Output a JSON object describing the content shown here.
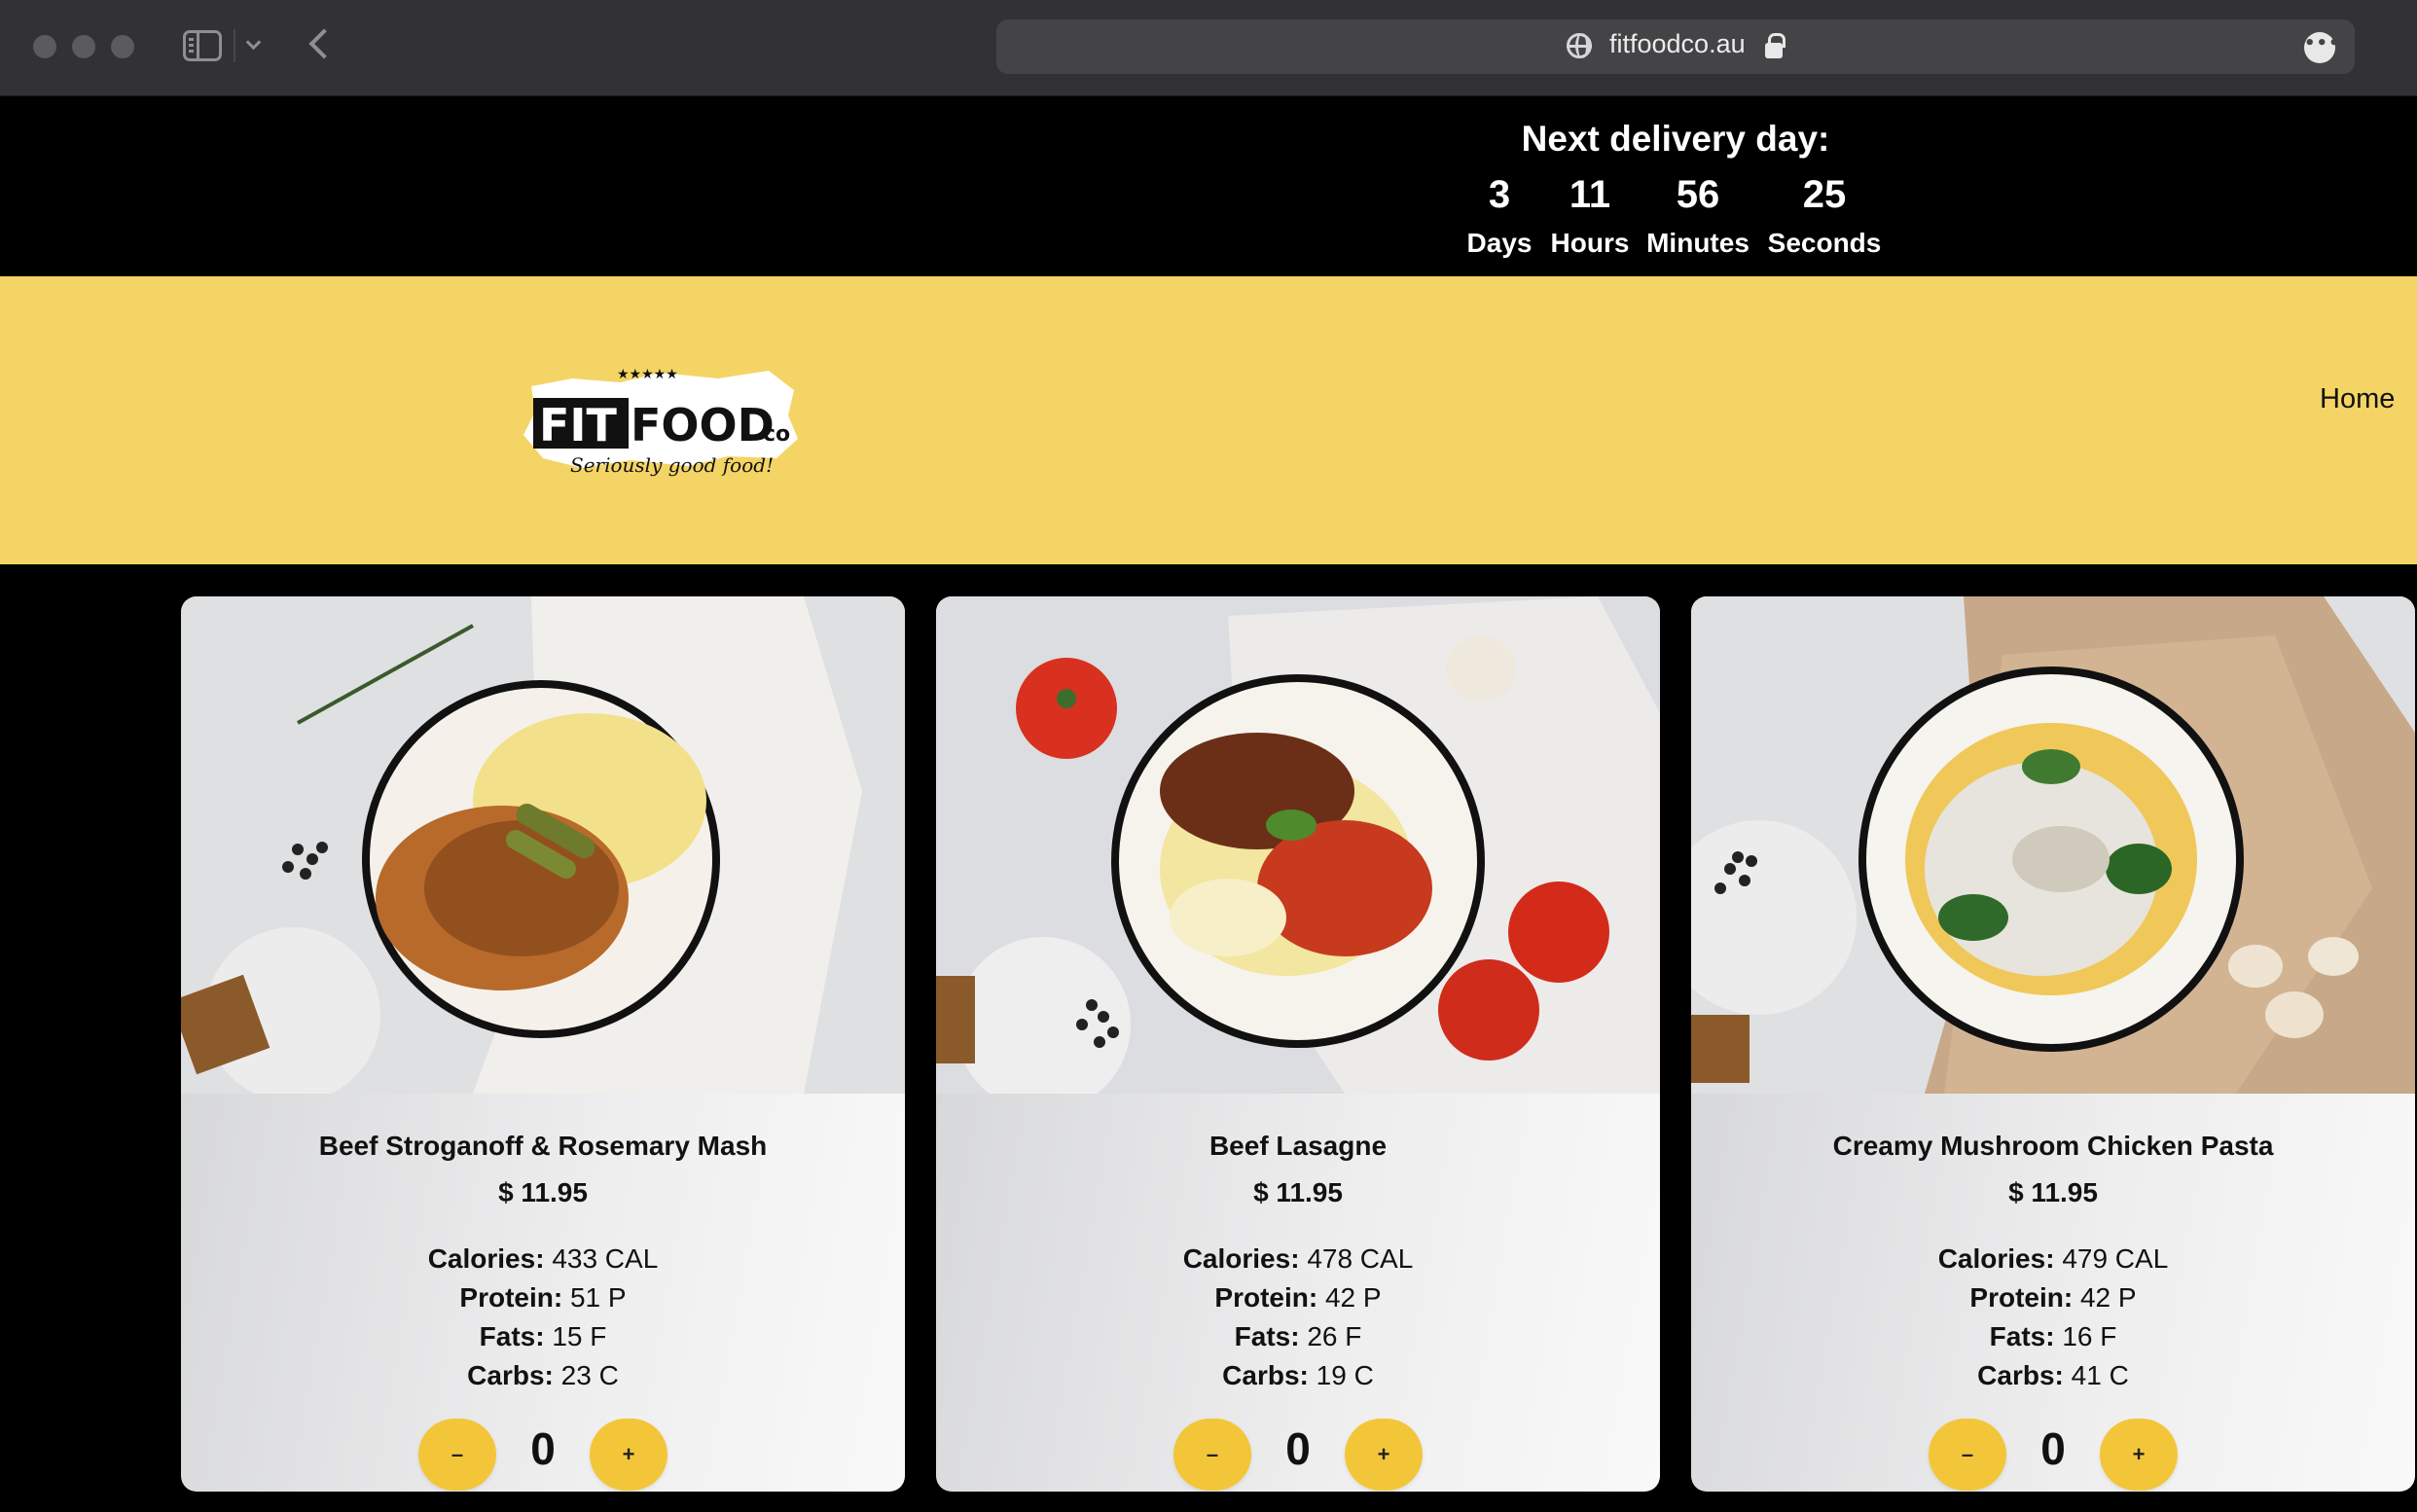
{
  "browser": {
    "url": "fitfoodco.au"
  },
  "countdown": {
    "title": "Next delivery day:",
    "units": [
      {
        "value": "3",
        "label": "Days"
      },
      {
        "value": "11",
        "label": "Hours"
      },
      {
        "value": "56",
        "label": "Minutes"
      },
      {
        "value": "25",
        "label": "Seconds"
      }
    ]
  },
  "header": {
    "logo": {
      "text_fit": "FIT",
      "text_food": "FOOD",
      "text_co": "co",
      "tagline": "Seriously good food!",
      "stars": "★★★★★"
    },
    "nav": {
      "home_label": "Home"
    }
  },
  "products": [
    {
      "name": "Beef Stroganoff & Rosemary Mash",
      "price": "$ 11.95",
      "calories_label": "Calories:",
      "calories": "433 CAL",
      "protein_label": "Protein:",
      "protein": "51 P",
      "fats_label": "Fats:",
      "fats": "15 F",
      "carbs_label": "Carbs:",
      "carbs": "23 C",
      "quantity": "0",
      "minus_label": "–",
      "plus_label": "+"
    },
    {
      "name": "Beef Lasagne",
      "price": "$ 11.95",
      "calories_label": "Calories:",
      "calories": "478 CAL",
      "protein_label": "Protein:",
      "protein": "42 P",
      "fats_label": "Fats:",
      "fats": "26 F",
      "carbs_label": "Carbs:",
      "carbs": "19 C",
      "quantity": "0",
      "minus_label": "–",
      "plus_label": "+"
    },
    {
      "name": "Creamy Mushroom Chicken Pasta",
      "price": "$ 11.95",
      "calories_label": "Calories:",
      "calories": "479 CAL",
      "protein_label": "Protein:",
      "protein": "42 P",
      "fats_label": "Fats:",
      "fats": "16 F",
      "carbs_label": "Carbs:",
      "carbs": "41 C",
      "quantity": "0",
      "minus_label": "–",
      "plus_label": "+"
    }
  ],
  "colors": {
    "brand_yellow": "#f4d464",
    "button_yellow": "#f3c63a",
    "black": "#000000"
  }
}
